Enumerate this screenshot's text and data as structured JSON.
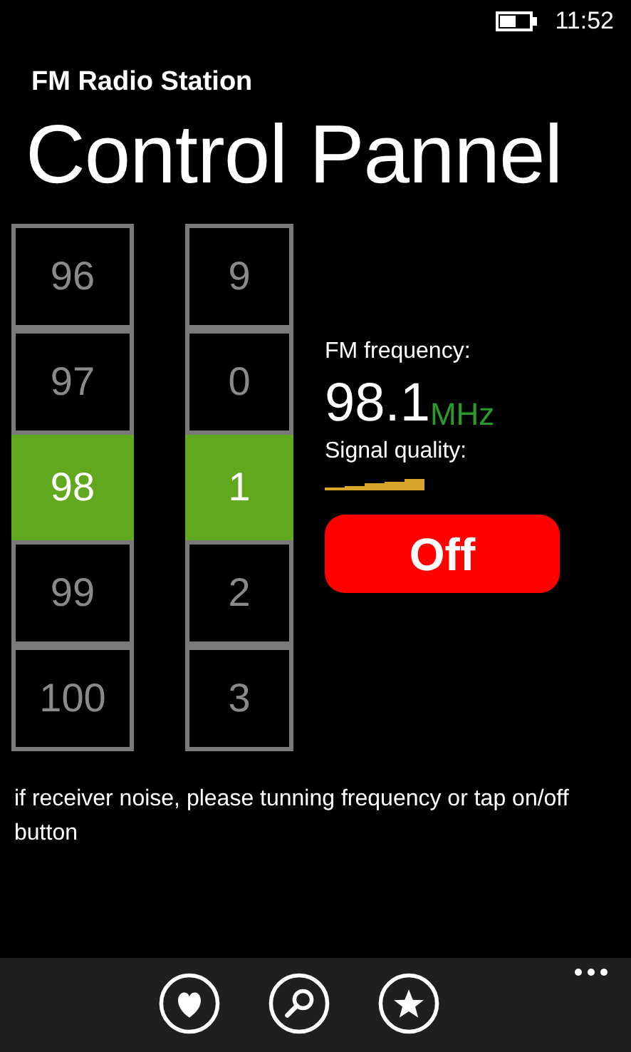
{
  "status_bar": {
    "time": "11:52"
  },
  "app_title": "FM Radio Station",
  "page_title": "Control Pannel",
  "pickers": [
    {
      "kind": "integer",
      "items": [
        {
          "label": "96",
          "selected": false
        },
        {
          "label": "97",
          "selected": false
        },
        {
          "label": "98",
          "selected": true
        },
        {
          "label": "99",
          "selected": false
        },
        {
          "label": "100",
          "selected": false
        }
      ]
    },
    {
      "kind": "decimal",
      "items": [
        {
          "label": "9",
          "selected": false
        },
        {
          "label": "0",
          "selected": false
        },
        {
          "label": "1",
          "selected": true
        },
        {
          "label": "2",
          "selected": false
        },
        {
          "label": "3",
          "selected": false
        }
      ]
    }
  ],
  "frequency": {
    "label": "FM frequency:",
    "value": "98.1",
    "unit": "MHz"
  },
  "signal": {
    "label": "Signal quality:"
  },
  "power_button": {
    "label": "Off"
  },
  "hint": "if receiver noise, please tunning frequency or tap on/off button",
  "app_bar": {
    "buttons": [
      {
        "kind": "heart"
      },
      {
        "kind": "search"
      },
      {
        "kind": "star"
      }
    ]
  }
}
